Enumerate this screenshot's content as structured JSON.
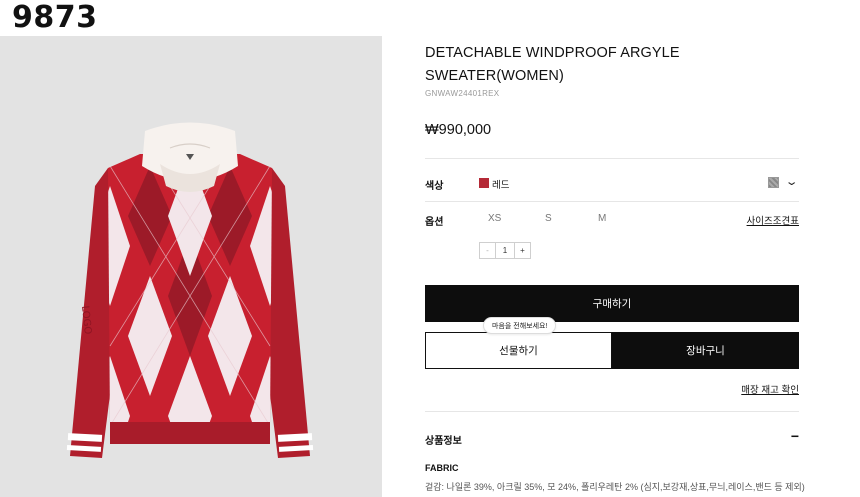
{
  "watermark": "9873",
  "product": {
    "title": "DETACHABLE WINDPROOF ARGYLE SWEATER(WOMEN)",
    "code": "GNWAW24401REX",
    "price": "₩990,000"
  },
  "options": {
    "color_label": "색상",
    "color_value": "레드",
    "color_hex": "#b52a37",
    "option_label": "옵션",
    "sizes": [
      "XS",
      "S",
      "M"
    ],
    "size_guide": "사이즈조견표",
    "quantity": "1",
    "minus": "-",
    "plus": "+"
  },
  "actions": {
    "buy": "구매하기",
    "gift_tip": "마음을 전해보세요!",
    "gift": "선물하기",
    "cart": "장바구니",
    "store_stock": "매장 재고 확인"
  },
  "details": {
    "section_title": "상품정보",
    "collapse_icon": "−",
    "fabric_title": "FABRIC",
    "fabric_text": "겉감: 나일론 39%, 아크릴 35%, 모 24%, 폴리우레탄 2% (심지,보강재,상표,무늬,레이스,밴드 등 제외)"
  },
  "image": {
    "alt": "red and white argyle hooded sweater",
    "accent": "#b01e2c"
  }
}
